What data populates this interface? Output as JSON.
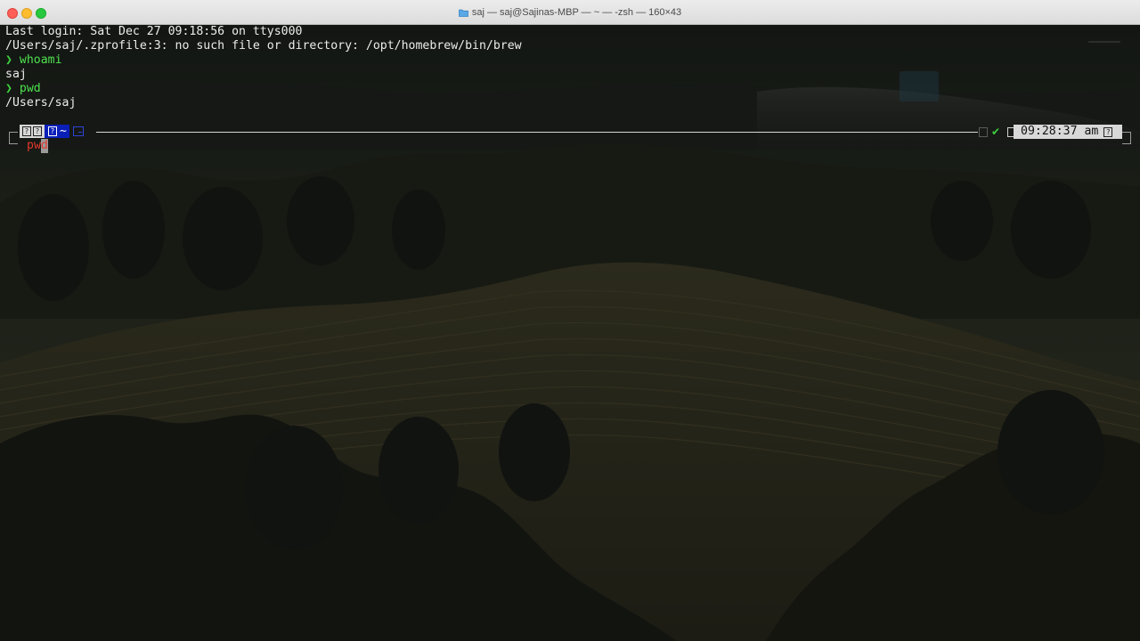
{
  "window": {
    "title": "saj — saj@Sajinas-MBP — ~ — -zsh — 160×43",
    "folder_icon": "folder-icon",
    "buttons": [
      "close",
      "minimize",
      "zoom"
    ],
    "colors": {
      "close": "#fe5f57",
      "minimize": "#febc2e",
      "zoom": "#28c840"
    }
  },
  "terminal": {
    "lines": [
      "Last login: Sat Dec 27 09:18:56 on ttys000",
      "/Users/saj/.zprofile:3: no such file or directory: /opt/homebrew/bin/brew"
    ],
    "history": [
      {
        "arrow": "❯",
        "command": "whoami",
        "output": "saj"
      },
      {
        "arrow": "❯",
        "command": "pwd",
        "output": "/Users/saj"
      }
    ],
    "prompt": {
      "left_glyphs": [
        "?",
        "?",
        "?"
      ],
      "dir": "~",
      "status_icon": "check-icon",
      "status_glyph": "✔",
      "time": "09:28:37 am",
      "time_glyph": "?",
      "accent_color": "#0a1fb8",
      "ok_color": "#3fd23f"
    },
    "input": {
      "typed": "pw",
      "cursor_char": "d",
      "color": "#e03a2e"
    }
  }
}
